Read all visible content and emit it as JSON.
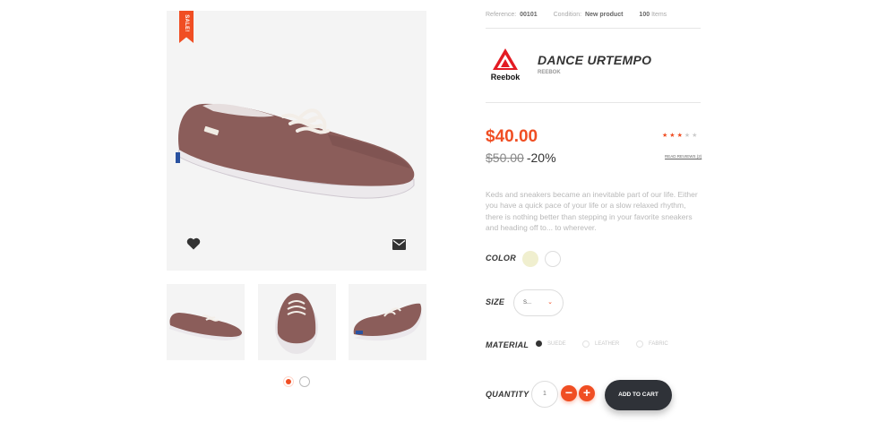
{
  "gallery": {
    "sale_label": "SALE!",
    "thumbnails": [
      "shoe-side-view",
      "shoe-front-view",
      "shoe-back-view"
    ],
    "pager_active": 1,
    "pager_count": 2
  },
  "meta": {
    "reference_label": "Reference:",
    "reference_value": "00101",
    "condition_label": "Condition:",
    "condition_value": "New product",
    "items_count": "100",
    "items_label": "Items"
  },
  "product": {
    "title": "DANCE URTEMPO",
    "brand": "REEBOK",
    "brand_logo_text": "Reebok",
    "price": "$40.00",
    "old_price": "$50.00",
    "discount": "-20%",
    "rating": 3,
    "rating_max": 5,
    "reviews_label": "READ REVIEWS (2)",
    "description": "Keds and sneakers became an inevitable part of our life. Either you have a quick pace of your life or a slow relaxed rhythm, there is nothing better than stepping in your favorite sneakers and heading off to... to wherever."
  },
  "options": {
    "color_label": "COLOR",
    "colors": [
      "#f0efcf",
      "#ffffff"
    ],
    "size_label": "SIZE",
    "size_value": "S...",
    "material_label": "MATERIAL",
    "materials": [
      {
        "label": "SUEDE",
        "selected": true
      },
      {
        "label": "LEATHER",
        "selected": false
      },
      {
        "label": "FABRIC",
        "selected": false
      }
    ],
    "quantity_label": "QUANTITY",
    "quantity_value": "1",
    "minus": "−",
    "plus": "+",
    "add_to_cart": "ADD TO CART"
  },
  "colors": {
    "accent": "#f04e23",
    "dark": "#2f3238",
    "shoe": "#8b5d5a"
  }
}
